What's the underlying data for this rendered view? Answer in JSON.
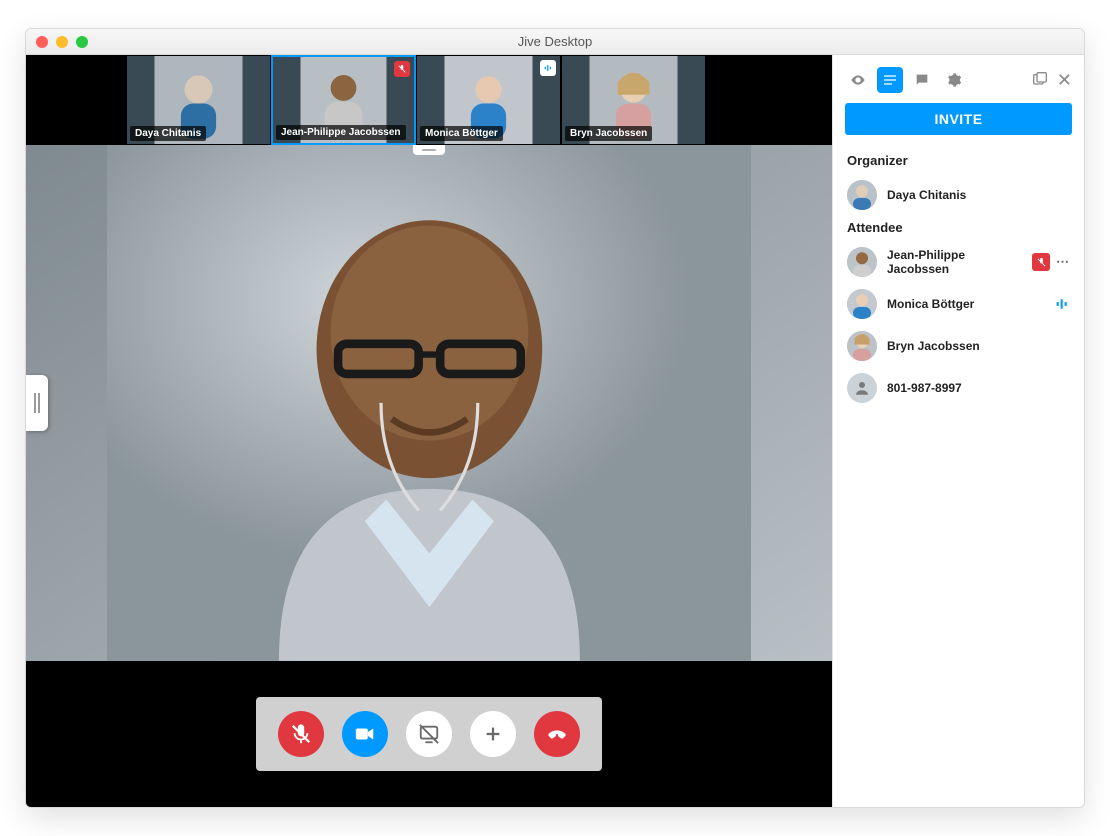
{
  "window": {
    "title": "Jive Desktop"
  },
  "thumbnails": [
    {
      "name": "Daya Chitanis",
      "status": null
    },
    {
      "name": "Jean-Philippe Jacobssen",
      "status": "muted"
    },
    {
      "name": "Monica Böttger",
      "status": "speaking"
    },
    {
      "name": "Bryn Jacobssen",
      "status": null
    }
  ],
  "sidebar": {
    "invite_label": "INVITE",
    "organizer_heading": "Organizer",
    "attendee_heading": "Attendee",
    "organizer": {
      "name": "Daya Chitanis"
    },
    "attendees": [
      {
        "name": "Jean-Philippe Jacobssen",
        "status": "muted",
        "has_menu": true
      },
      {
        "name": "Monica Böttger",
        "status": "speaking"
      },
      {
        "name": "Bryn Jacobssen"
      },
      {
        "name": "801-987-8997",
        "is_phone": true
      }
    ]
  },
  "colors": {
    "accent": "#0099ff",
    "danger": "#e0383e"
  }
}
